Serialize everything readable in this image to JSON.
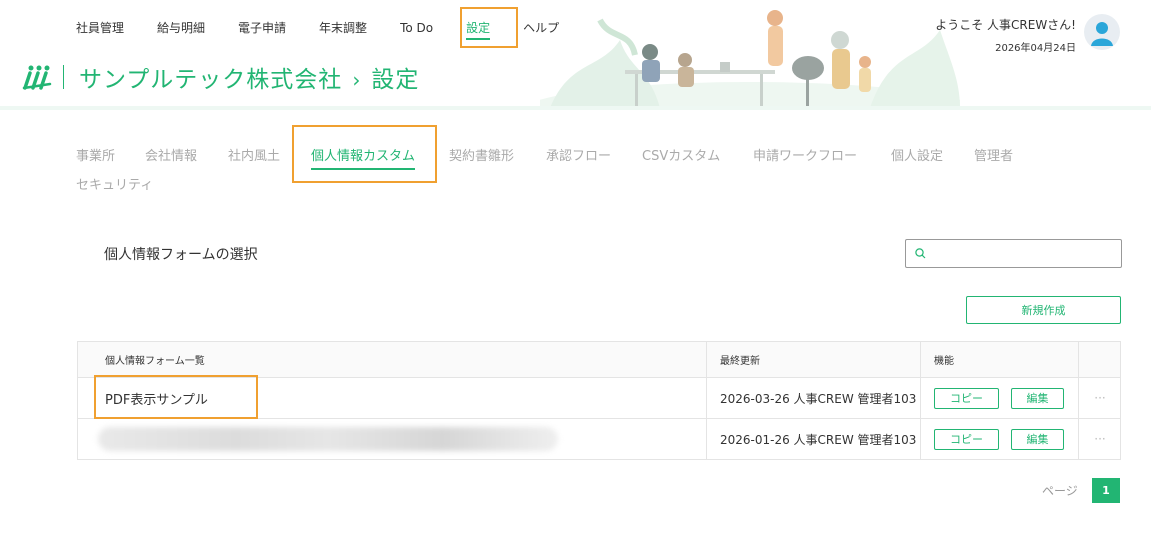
{
  "topnav": {
    "items": [
      "社員管理",
      "給与明細",
      "電子申請",
      "年末調整",
      "To Do",
      "設定",
      "ヘルプ"
    ]
  },
  "header": {
    "company": "サンプルテック株式会社",
    "page": "設定",
    "chevron": "›",
    "greeting": "ようこそ 人事CREWさん!",
    "date": "2026年04月24日"
  },
  "subtabs": [
    "事業所",
    "会社情報",
    "社内風土",
    "個人情報カスタム",
    "契約書雛形",
    "承認フロー",
    "CSVカスタム",
    "申請ワークフロー",
    "個人設定",
    "管理者",
    "セキュリティ"
  ],
  "section": {
    "title": "個人情報フォームの選択",
    "search_placeholder": "",
    "new_button": "新規作成"
  },
  "table": {
    "headers": [
      "個人情報フォーム一覧",
      "最終更新",
      "機能",
      ""
    ],
    "rows": [
      {
        "name": "PDF表示サンプル",
        "updated": "2026-03-26 人事CREW 管理者103",
        "copy": "コピー",
        "edit": "編集",
        "more": "···"
      },
      {
        "name": "",
        "updated": "2026-01-26 人事CREW 管理者103",
        "copy": "コピー",
        "edit": "編集",
        "more": "···"
      }
    ]
  },
  "pager": {
    "label": "ページ",
    "current": "1"
  },
  "colors": {
    "accent": "#22b573",
    "highlight": "#f0a030"
  }
}
